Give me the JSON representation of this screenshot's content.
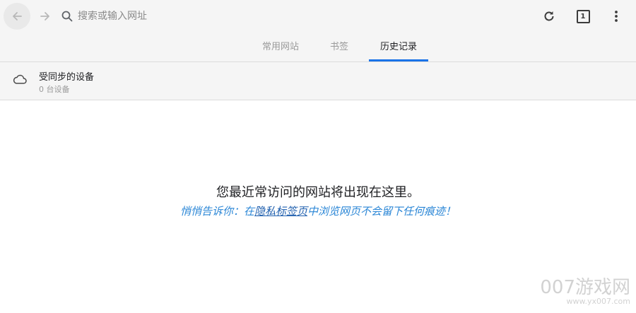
{
  "toolbar": {
    "back_icon": "arrow-left-icon",
    "forward_icon": "arrow-right-icon",
    "search_icon": "search-icon",
    "search_placeholder": "搜索或输入网址",
    "reload_icon": "reload-icon",
    "tab_count": "1",
    "menu_icon": "more-vert-icon"
  },
  "tabs": [
    {
      "label": "常用网站",
      "active": false
    },
    {
      "label": "书签",
      "active": false
    },
    {
      "label": "历史记录",
      "active": true
    }
  ],
  "synced_devices": {
    "icon": "cloud-icon",
    "title": "受同步的设备",
    "subtitle": "0 台设备"
  },
  "empty_state": {
    "title": "您最近常访问的网站将出现在这里。",
    "tip_before": "悄悄告诉你：在",
    "tip_link": "隐私标签页",
    "tip_after": "中浏览网页不会留下任何痕迹！"
  },
  "watermark": {
    "text": "007游戏网",
    "url": "www.yx007.com"
  },
  "colors": {
    "accent": "#1a73e8",
    "tip_text": "#2a86d6",
    "toolbar_bg": "#f5f5f5"
  }
}
